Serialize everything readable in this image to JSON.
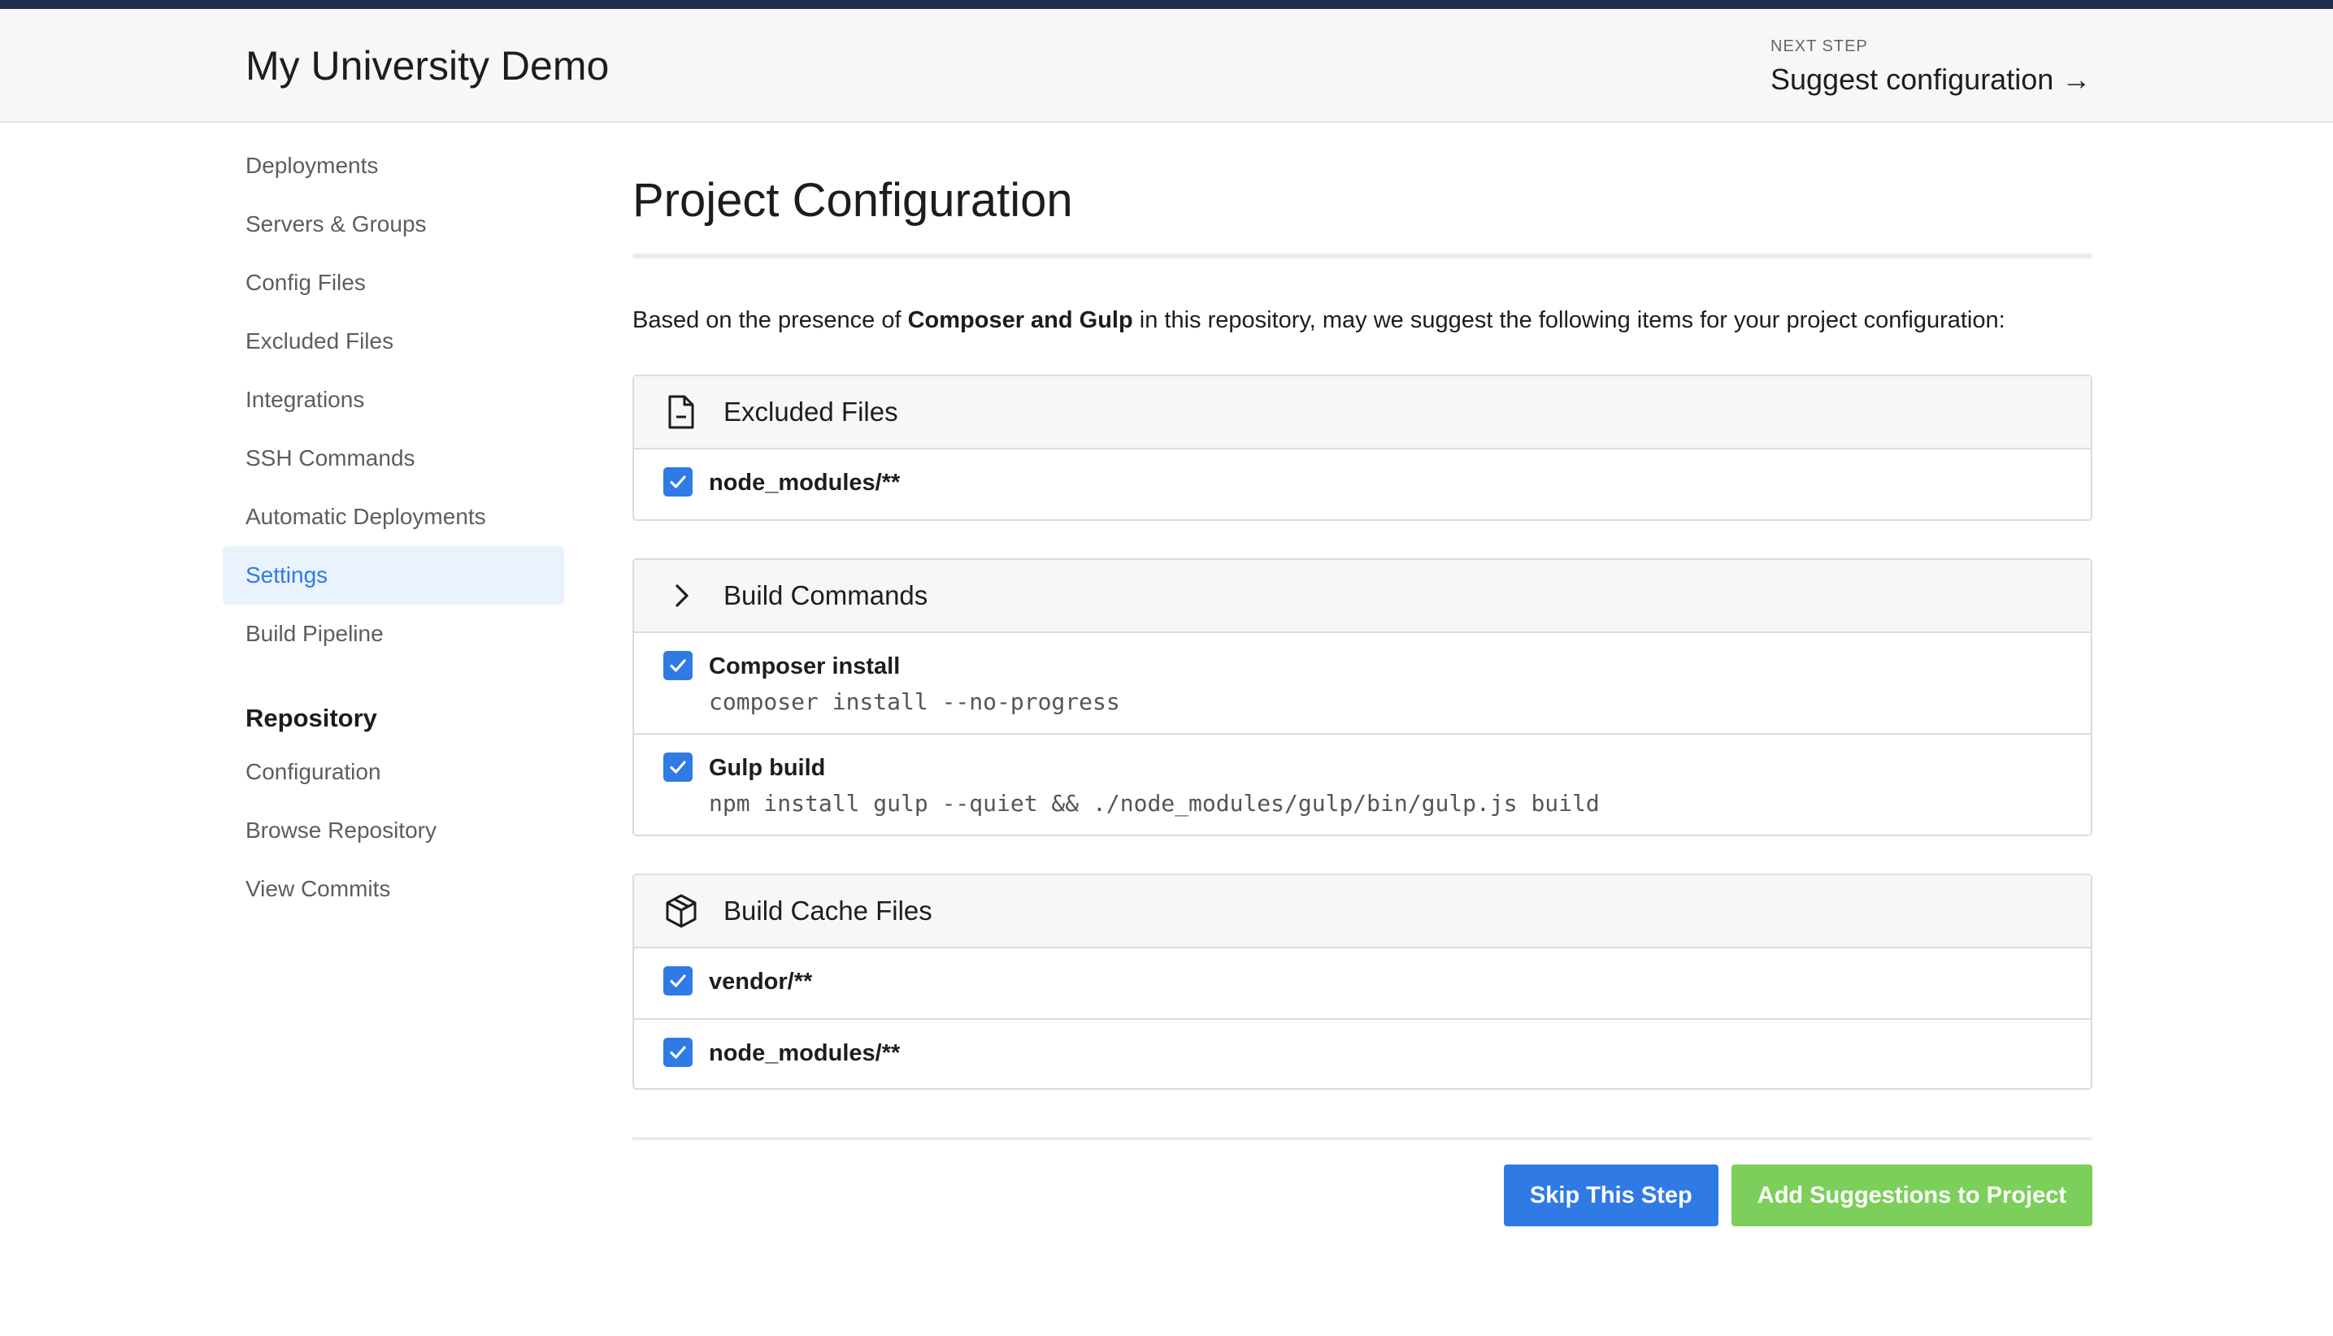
{
  "header": {
    "app_title": "My University Demo",
    "next_step_label": "NEXT STEP",
    "next_step_link": "Suggest configuration →"
  },
  "sidebar": {
    "items": [
      {
        "label": "Deployments"
      },
      {
        "label": "Servers & Groups"
      },
      {
        "label": "Config Files"
      },
      {
        "label": "Excluded Files"
      },
      {
        "label": "Integrations"
      },
      {
        "label": "SSH Commands"
      },
      {
        "label": "Automatic Deployments"
      },
      {
        "label": "Settings",
        "active": true
      },
      {
        "label": "Build Pipeline"
      }
    ],
    "repository_heading": "Repository",
    "repository_items": [
      {
        "label": "Configuration"
      },
      {
        "label": "Browse Repository"
      },
      {
        "label": "View Commits"
      }
    ]
  },
  "main": {
    "title": "Project Configuration",
    "intro_prefix": "Based on the presence of ",
    "intro_bold": "Composer and Gulp",
    "intro_suffix": " in this repository, may we suggest the following items for your project configuration:",
    "panels": [
      {
        "title": "Excluded Files",
        "icon": "file-icon",
        "items": [
          {
            "label": "node_modules/**",
            "checked": true
          }
        ]
      },
      {
        "title": "Build Commands",
        "icon": "chevron-right-icon",
        "items": [
          {
            "label": "Composer install",
            "command": "composer install --no-progress",
            "checked": true
          },
          {
            "label": "Gulp build",
            "command": "npm install gulp --quiet && ./node_modules/gulp/bin/gulp.js build",
            "checked": true
          }
        ]
      },
      {
        "title": "Build Cache Files",
        "icon": "package-icon",
        "items": [
          {
            "label": "vendor/**",
            "checked": true
          },
          {
            "label": "node_modules/**",
            "checked": true
          }
        ]
      }
    ],
    "skip_button": "Skip This Step",
    "add_button": "Add Suggestions to Project"
  },
  "colors": {
    "accent": "#2f7ae5",
    "success": "#7bcf5a",
    "topbar": "#1e2f4d"
  }
}
